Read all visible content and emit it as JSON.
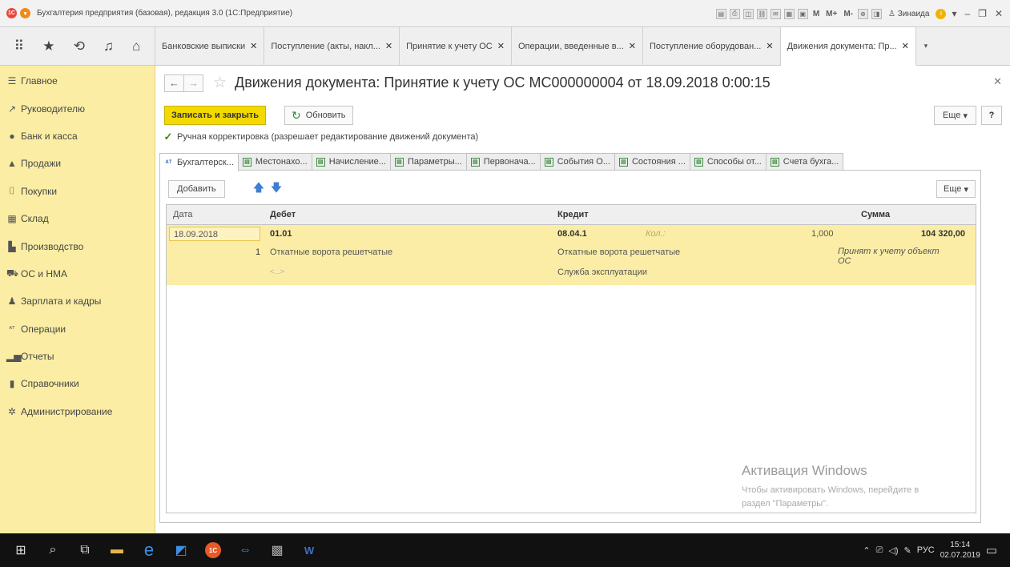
{
  "window": {
    "title": "Бухгалтерия предприятия (базовая), редакция 3.0 (1С:Предприятие)",
    "toolbar_buttons": [
      "M",
      "M+",
      "M-"
    ],
    "user": "Зинаида"
  },
  "tabs": [
    {
      "label": "Банковские выписки",
      "active": false
    },
    {
      "label": "Поступление (акты, накл...",
      "active": false
    },
    {
      "label": "Принятие к учету ОС",
      "active": false
    },
    {
      "label": "Операции, введенные в...",
      "active": false
    },
    {
      "label": "Поступление оборудован...",
      "active": false
    },
    {
      "label": "Движения документа: Пр...",
      "active": true
    }
  ],
  "sidebar": {
    "items": [
      {
        "label": "Главное",
        "icon": "menu-icon"
      },
      {
        "label": "Руководителю",
        "icon": "trend-icon"
      },
      {
        "label": "Банк и касса",
        "icon": "coin-icon"
      },
      {
        "label": "Продажи",
        "icon": "bag-icon"
      },
      {
        "label": "Покупки",
        "icon": "cart-icon"
      },
      {
        "label": "Склад",
        "icon": "warehouse-icon"
      },
      {
        "label": "Производство",
        "icon": "factory-icon"
      },
      {
        "label": "ОС и НМА",
        "icon": "truck-icon"
      },
      {
        "label": "Зарплата и кадры",
        "icon": "person-icon"
      },
      {
        "label": "Операции",
        "icon": "dt-kt-icon"
      },
      {
        "label": "Отчеты",
        "icon": "bar-chart-icon"
      },
      {
        "label": "Справочники",
        "icon": "book-icon"
      },
      {
        "label": "Администрирование",
        "icon": "gear-icon"
      }
    ]
  },
  "doc": {
    "title": "Движения документа: Принятие к учету ОС МС000000004 от 18.09.2018 0:00:15",
    "save_close": "Записать и закрыть",
    "refresh": "Обновить",
    "more": "Еще",
    "help": "?",
    "manual_checkbox": "Ручная корректировка (разрешает редактирование движений документа)"
  },
  "subtabs": [
    {
      "label": "Бухгалтерск...",
      "icon": "dt-kt-icon",
      "active": true
    },
    {
      "label": "Местонахо...",
      "icon": "register-icon",
      "active": false
    },
    {
      "label": "Начисление...",
      "icon": "register-icon",
      "active": false
    },
    {
      "label": "Параметры...",
      "icon": "register-icon",
      "active": false
    },
    {
      "label": "Первонача...",
      "icon": "register-icon",
      "active": false
    },
    {
      "label": "События О...",
      "icon": "register-icon",
      "active": false
    },
    {
      "label": "Состояния ...",
      "icon": "register-icon",
      "active": false
    },
    {
      "label": "Способы от...",
      "icon": "register-icon",
      "active": false
    },
    {
      "label": "Счета бухга...",
      "icon": "register-icon",
      "active": false
    }
  ],
  "table": {
    "add": "Добавить",
    "more": "Еще",
    "columns": {
      "date": "Дата",
      "debit": "Дебет",
      "credit": "Кредит",
      "sum": "Сумма"
    },
    "row": {
      "date": "18.09.2018",
      "debit_account": "01.01",
      "credit_account": "08.04.1",
      "kol_label": "Кол.:",
      "quantity": "1,000",
      "sum": "104 320,00",
      "debit_qty": "1",
      "debit_sub1": "Откатные ворота решетчатые",
      "credit_sub1": "Откатные ворота решетчатые",
      "comment": "Принят к учету объект ОС",
      "debit_sub2": "<...>",
      "credit_sub2": "Служба эксплуатации"
    }
  },
  "watermark": {
    "title": "Активация Windows",
    "line1": "Чтобы активировать Windows, перейдите в",
    "line2": "раздел \"Параметры\"."
  },
  "taskbar": {
    "lang": "РУС",
    "time": "15:14",
    "date": "02.07.2019"
  }
}
